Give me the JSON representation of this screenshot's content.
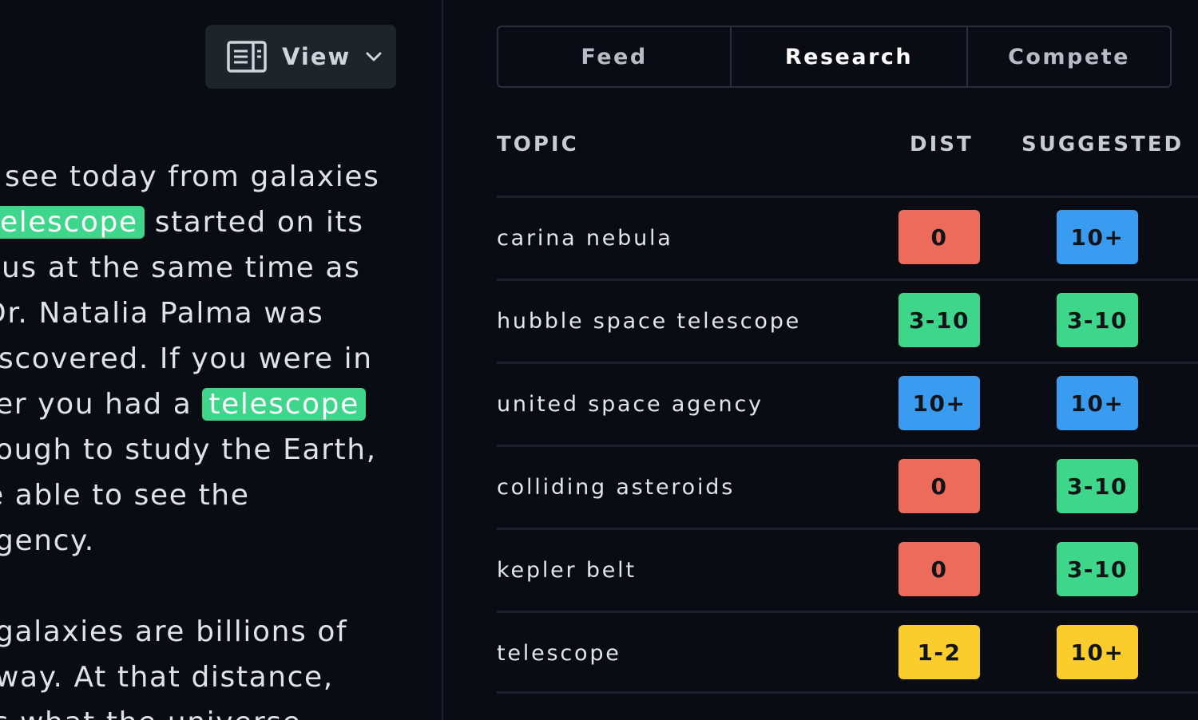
{
  "toolbar": {
    "view_label": "View",
    "view_icon": "layout-icon",
    "chevron_icon": "chevron-down-icon"
  },
  "editor": {
    "lines": [
      {
        "before": "see today from galaxies",
        "highlight": "",
        "after": ""
      },
      {
        "before": "",
        "highlight": "elescope",
        "after": " started on its"
      },
      {
        "before": "us at the same time as",
        "highlight": "",
        "after": ""
      },
      {
        "before": "Dr. Natalia Palma was",
        "highlight": "",
        "after": ""
      },
      {
        "before": "scovered. If you were in",
        "highlight": "",
        "after": ""
      },
      {
        "before": "er you had a ",
        "highlight": "telescope",
        "after": ""
      },
      {
        "before": "ough to study the Earth,",
        "highlight": "",
        "after": ""
      },
      {
        "before": "e able to see the",
        "highlight": "",
        "after": ""
      },
      {
        "before": "gency.",
        "highlight": "",
        "after": ""
      },
      {
        "before": "galaxies are billions of",
        "highlight": "",
        "after": ""
      },
      {
        "before": "way. At that distance,",
        "highlight": "",
        "after": ""
      },
      {
        "before": "ls what the universe",
        "highlight": "",
        "after": ""
      }
    ],
    "highlight_color": "#3ed68a"
  },
  "tabs": [
    {
      "label": "Feed",
      "active": false
    },
    {
      "label": "Research",
      "active": true
    },
    {
      "label": "Compete",
      "active": false
    }
  ],
  "table": {
    "headers": {
      "topic": "TOPIC",
      "dist": "DIST",
      "suggested": "SUGGESTED"
    },
    "rows": [
      {
        "topic": "carina nebula",
        "dist": "0",
        "dist_color": "red",
        "suggested": "10+",
        "suggested_color": "blue"
      },
      {
        "topic": "hubble space telescope",
        "dist": "3-10",
        "dist_color": "green",
        "suggested": "3-10",
        "suggested_color": "green"
      },
      {
        "topic": "united space agency",
        "dist": "10+",
        "dist_color": "blue",
        "suggested": "10+",
        "suggested_color": "blue"
      },
      {
        "topic": "colliding asteroids",
        "dist": "0",
        "dist_color": "red",
        "suggested": "3-10",
        "suggested_color": "green"
      },
      {
        "topic": "kepler belt",
        "dist": "0",
        "dist_color": "red",
        "suggested": "3-10",
        "suggested_color": "green"
      },
      {
        "topic": "telescope",
        "dist": "1-2",
        "dist_color": "yellow",
        "suggested": "10+",
        "suggested_color": "yellow"
      }
    ]
  },
  "colors": {
    "background": "#090c12",
    "red": "#ec6b5b",
    "green": "#3ed68a",
    "blue": "#3a9cf0",
    "yellow": "#fbcd2c"
  }
}
